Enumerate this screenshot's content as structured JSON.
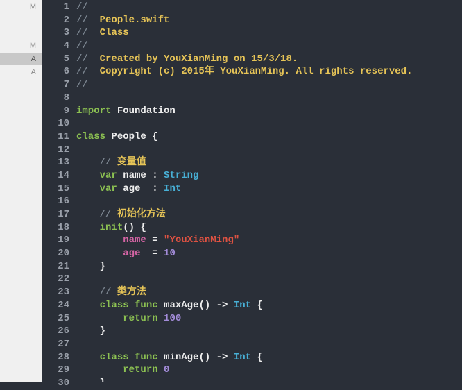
{
  "ruler": {
    "marks": [
      {
        "line": 1,
        "label": "M",
        "active": false
      },
      {
        "line": 4,
        "label": "M",
        "active": false
      },
      {
        "line": 5,
        "label": "A",
        "active": true
      },
      {
        "line": 6,
        "label": "A",
        "active": false
      }
    ]
  },
  "lines": {
    "1": [
      {
        "cls": "c-comment",
        "txt": "//"
      }
    ],
    "2": [
      {
        "cls": "c-comment",
        "txt": "//  "
      },
      {
        "cls": "c-gold",
        "txt": "People.swift"
      }
    ],
    "3": [
      {
        "cls": "c-comment",
        "txt": "//  "
      },
      {
        "cls": "c-gold",
        "txt": "Class"
      }
    ],
    "4": [
      {
        "cls": "c-comment",
        "txt": "//"
      }
    ],
    "5": [
      {
        "cls": "c-comment",
        "txt": "//  "
      },
      {
        "cls": "c-gold",
        "txt": "Created by YouXianMing on 15/3/18."
      }
    ],
    "6": [
      {
        "cls": "c-comment",
        "txt": "//  "
      },
      {
        "cls": "c-gold",
        "txt": "Copyright (c) 2015年 YouXianMing. All rights reserved."
      }
    ],
    "7": [
      {
        "cls": "c-comment",
        "txt": "//"
      }
    ],
    "8": [],
    "9": [
      {
        "cls": "c-key",
        "txt": "import"
      },
      {
        "cls": "c-ident",
        "txt": " Foundation"
      }
    ],
    "10": [],
    "11": [
      {
        "cls": "c-key",
        "txt": "class"
      },
      {
        "cls": "c-ident",
        "txt": " People "
      },
      {
        "cls": "c-brace",
        "txt": "{"
      }
    ],
    "12": [],
    "13": [
      {
        "cls": "c-ident",
        "txt": "    "
      },
      {
        "cls": "c-comment",
        "txt": "// "
      },
      {
        "cls": "c-gold",
        "txt": "变量值"
      }
    ],
    "14": [
      {
        "cls": "c-ident",
        "txt": "    "
      },
      {
        "cls": "c-key",
        "txt": "var"
      },
      {
        "cls": "c-ident",
        "txt": " name : "
      },
      {
        "cls": "c-type",
        "txt": "String"
      }
    ],
    "15": [
      {
        "cls": "c-ident",
        "txt": "    "
      },
      {
        "cls": "c-key",
        "txt": "var"
      },
      {
        "cls": "c-ident",
        "txt": " age  : "
      },
      {
        "cls": "c-type",
        "txt": "Int"
      }
    ],
    "16": [],
    "17": [
      {
        "cls": "c-ident",
        "txt": "    "
      },
      {
        "cls": "c-comment",
        "txt": "// "
      },
      {
        "cls": "c-gold",
        "txt": "初始化方法"
      }
    ],
    "18": [
      {
        "cls": "c-ident",
        "txt": "    "
      },
      {
        "cls": "c-key",
        "txt": "init"
      },
      {
        "cls": "c-ident",
        "txt": "() "
      },
      {
        "cls": "c-brace",
        "txt": "{"
      }
    ],
    "19": [
      {
        "cls": "c-ident",
        "txt": "        "
      },
      {
        "cls": "c-prop",
        "txt": "name"
      },
      {
        "cls": "c-op",
        "txt": " = "
      },
      {
        "cls": "c-str",
        "txt": "\"YouXianMing\""
      }
    ],
    "20": [
      {
        "cls": "c-ident",
        "txt": "        "
      },
      {
        "cls": "c-prop",
        "txt": "age"
      },
      {
        "cls": "c-op",
        "txt": "  = "
      },
      {
        "cls": "c-num",
        "txt": "10"
      }
    ],
    "21": [
      {
        "cls": "c-ident",
        "txt": "    "
      },
      {
        "cls": "c-brace",
        "txt": "}"
      }
    ],
    "22": [],
    "23": [
      {
        "cls": "c-ident",
        "txt": "    "
      },
      {
        "cls": "c-comment",
        "txt": "// "
      },
      {
        "cls": "c-gold",
        "txt": "类方法"
      }
    ],
    "24": [
      {
        "cls": "c-ident",
        "txt": "    "
      },
      {
        "cls": "c-key",
        "txt": "class"
      },
      {
        "cls": "c-ident",
        "txt": " "
      },
      {
        "cls": "c-func-kw",
        "txt": "func"
      },
      {
        "cls": "c-ident",
        "txt": " maxAge() -> "
      },
      {
        "cls": "c-type",
        "txt": "Int"
      },
      {
        "cls": "c-ident",
        "txt": " "
      },
      {
        "cls": "c-brace",
        "txt": "{"
      }
    ],
    "25": [
      {
        "cls": "c-ident",
        "txt": "        "
      },
      {
        "cls": "c-key",
        "txt": "return"
      },
      {
        "cls": "c-ident",
        "txt": " "
      },
      {
        "cls": "c-num",
        "txt": "100"
      }
    ],
    "26": [
      {
        "cls": "c-ident",
        "txt": "    "
      },
      {
        "cls": "c-brace",
        "txt": "}"
      }
    ],
    "27": [],
    "28": [
      {
        "cls": "c-ident",
        "txt": "    "
      },
      {
        "cls": "c-key",
        "txt": "class"
      },
      {
        "cls": "c-ident",
        "txt": " "
      },
      {
        "cls": "c-func-kw",
        "txt": "func"
      },
      {
        "cls": "c-ident",
        "txt": " minAge() -> "
      },
      {
        "cls": "c-type",
        "txt": "Int"
      },
      {
        "cls": "c-ident",
        "txt": " "
      },
      {
        "cls": "c-brace",
        "txt": "{"
      }
    ],
    "29": [
      {
        "cls": "c-ident",
        "txt": "        "
      },
      {
        "cls": "c-key",
        "txt": "return"
      },
      {
        "cls": "c-ident",
        "txt": " "
      },
      {
        "cls": "c-num",
        "txt": "0"
      }
    ],
    "30": [
      {
        "cls": "c-ident",
        "txt": "    "
      },
      {
        "cls": "c-brace",
        "txt": "}"
      }
    ]
  },
  "lineCount": 30,
  "lineHeight": 18.7
}
